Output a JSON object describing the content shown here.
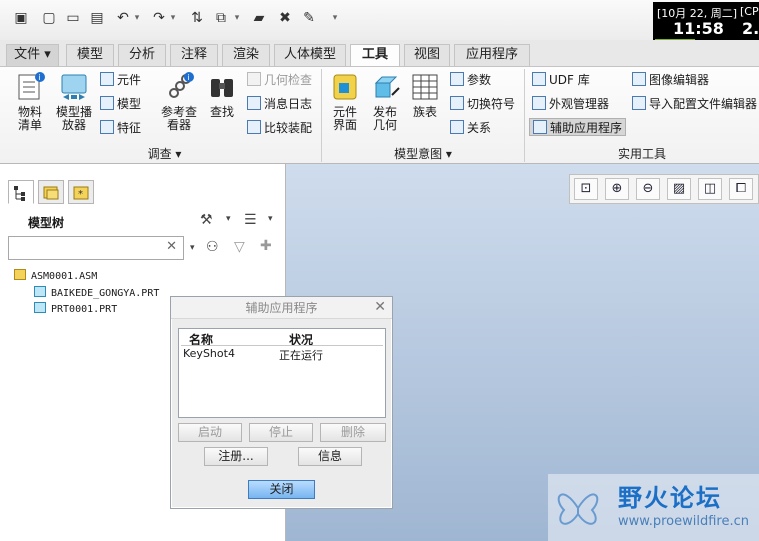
{
  "quick_access": {
    "icons": [
      "window-icon",
      "new-icon",
      "open-icon",
      "save-icon",
      "undo-icon",
      "redo-icon",
      "regenerate-icon",
      "windows-icon",
      "folder-icon",
      "close-window-icon",
      "edit-icon",
      "customize-icon"
    ]
  },
  "clock": {
    "date": "[10月 22, 周二]",
    "time": "11:58",
    "cpu_label": "[CP",
    "cpu_value": "2."
  },
  "tabs": [
    {
      "label": "文件 ▾"
    },
    {
      "label": "模型"
    },
    {
      "label": "分析"
    },
    {
      "label": "注释"
    },
    {
      "label": "渲染"
    },
    {
      "label": "人体模型"
    },
    {
      "label": "工具",
      "active": true
    },
    {
      "label": "视图"
    },
    {
      "label": "应用程序"
    }
  ],
  "ribbon": {
    "investigate": {
      "bom": "物料\n清单",
      "model_player": "模型播\n放器",
      "component": "元件",
      "model": "模型",
      "feature": "特征",
      "reference_viewer": "参考查\n看器",
      "find": "查找",
      "geometry_check": "几何检查",
      "message_log": "消息日志",
      "compare_assembly": "比较装配",
      "group_label": "调查 ▾"
    },
    "model_intent": {
      "component_interface": "元件\n界面",
      "publish_geometry": "发布\n几何",
      "family_table": "族表",
      "parameters": "参数",
      "switch_symbols": "切换符号",
      "relations": "关系",
      "group_label": "模型意图 ▾"
    },
    "utilities": {
      "udf_library": "UDF 库",
      "appearance_manager": "外观管理器",
      "auxiliary_applications": "辅助应用程序",
      "image_editor": "图像编辑器",
      "import_config_editor": "导入配置文件编辑器",
      "group_label": "实用工具"
    }
  },
  "model_tree": {
    "title": "模型树",
    "search_placeholder": "",
    "nodes": [
      {
        "label": "ASM0001.ASM",
        "type": "assembly"
      },
      {
        "label": "BAIKEDE_GONGYA.PRT",
        "type": "part"
      },
      {
        "label": "PRT0001.PRT",
        "type": "part"
      }
    ]
  },
  "dialog": {
    "title": "辅助应用程序",
    "columns": [
      "名称",
      "状况"
    ],
    "rows": [
      {
        "name": "KeyShot4",
        "status": "正在运行"
      }
    ],
    "buttons": {
      "start": "启动",
      "stop": "停止",
      "delete": "删除",
      "register": "注册...",
      "info": "信息",
      "close": "关闭"
    }
  },
  "watermark": {
    "name": "野火论坛",
    "url": "www.proewildfire.cn"
  },
  "colors": {
    "accent_blue": "#78b5f0",
    "graphics_top": "#cfdced",
    "graphics_bottom": "#9fb6d2",
    "cpu_bar": "#7bb51a"
  }
}
